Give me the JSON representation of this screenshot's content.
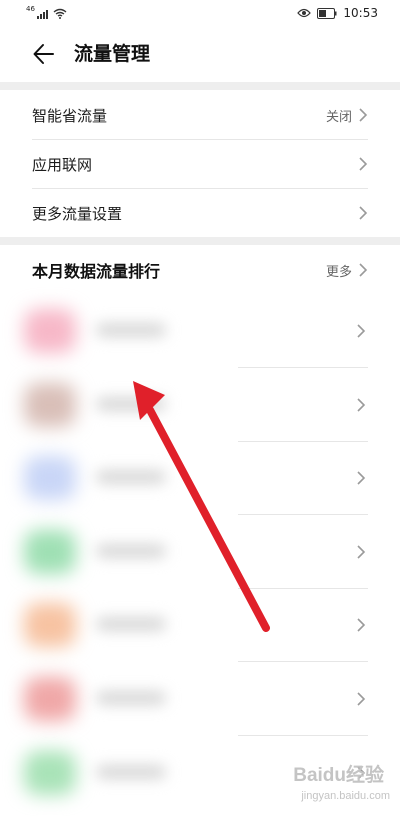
{
  "status_bar": {
    "signal_badge": "46",
    "time": "10:53",
    "icons": [
      "signal-icon",
      "wifi-icon",
      "eye-comfort-icon",
      "battery-icon"
    ]
  },
  "header": {
    "title": "流量管理",
    "back_icon": "arrow-left-icon"
  },
  "settings": {
    "items": [
      {
        "label": "智能省流量",
        "value": "关闭"
      },
      {
        "label": "应用联网",
        "value": ""
      },
      {
        "label": "更多流量设置",
        "value": ""
      }
    ]
  },
  "ranking": {
    "title": "本月数据流量排行",
    "more": "更多",
    "apps": [
      {
        "icon_color": "#f7b8c8"
      },
      {
        "icon_color": "#d9bfb8"
      },
      {
        "icon_color": "#c9d6f7"
      },
      {
        "icon_color": "#9fe0b4"
      },
      {
        "icon_color": "#f7c3a2"
      },
      {
        "icon_color": "#f0a8a8"
      },
      {
        "icon_color": "#a9e3b8"
      }
    ]
  },
  "overlay": {
    "arrow_color": "#e0202a"
  },
  "watermark": {
    "brand": "Baidu经验",
    "domain": "jingyan.baidu.com"
  }
}
